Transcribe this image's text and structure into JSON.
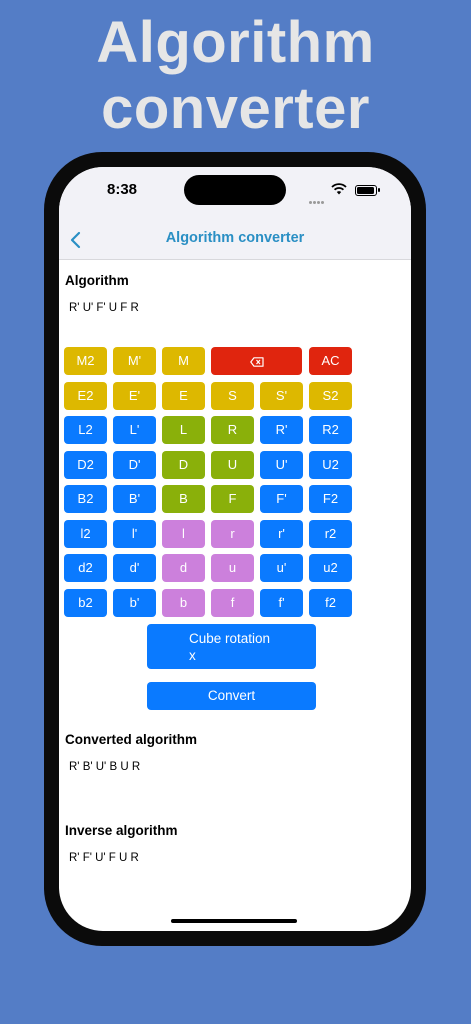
{
  "promo": {
    "line1": "Algorithm",
    "line2": "converter"
  },
  "status_bar": {
    "time": "8:38"
  },
  "nav": {
    "title": "Algorithm converter"
  },
  "algorithm": {
    "title": "Algorithm",
    "value": "R' U' F' U F R"
  },
  "keypad": {
    "rows": [
      [
        "M2",
        "M'",
        "M",
        "⌫",
        "AC"
      ],
      [
        "E2",
        "E'",
        "E",
        "S",
        "S'",
        "S2"
      ],
      [
        "L2",
        "L'",
        "L",
        "R",
        "R'",
        "R2"
      ],
      [
        "D2",
        "D'",
        "D",
        "U",
        "U'",
        "U2"
      ],
      [
        "B2",
        "B'",
        "B",
        "F",
        "F'",
        "F2"
      ],
      [
        "l2",
        "l'",
        "l",
        "r",
        "r'",
        "r2"
      ],
      [
        "d2",
        "d'",
        "d",
        "u",
        "u'",
        "u2"
      ],
      [
        "b2",
        "b'",
        "b",
        "f",
        "f'",
        "f2"
      ]
    ],
    "colors": {
      "yellow": "#ddb800",
      "red": "#e0250e",
      "blue": "#0a7aff",
      "green": "#8ab00a",
      "purple": "#cc80dc"
    }
  },
  "cube_rotation": {
    "label": "Cube rotation",
    "value": "x"
  },
  "convert_button": {
    "label": "Convert"
  },
  "converted": {
    "title": "Converted algorithm",
    "value": "R' B' U' B U R"
  },
  "inverse": {
    "title": "Inverse algorithm",
    "value": "R' F' U' F U R"
  }
}
